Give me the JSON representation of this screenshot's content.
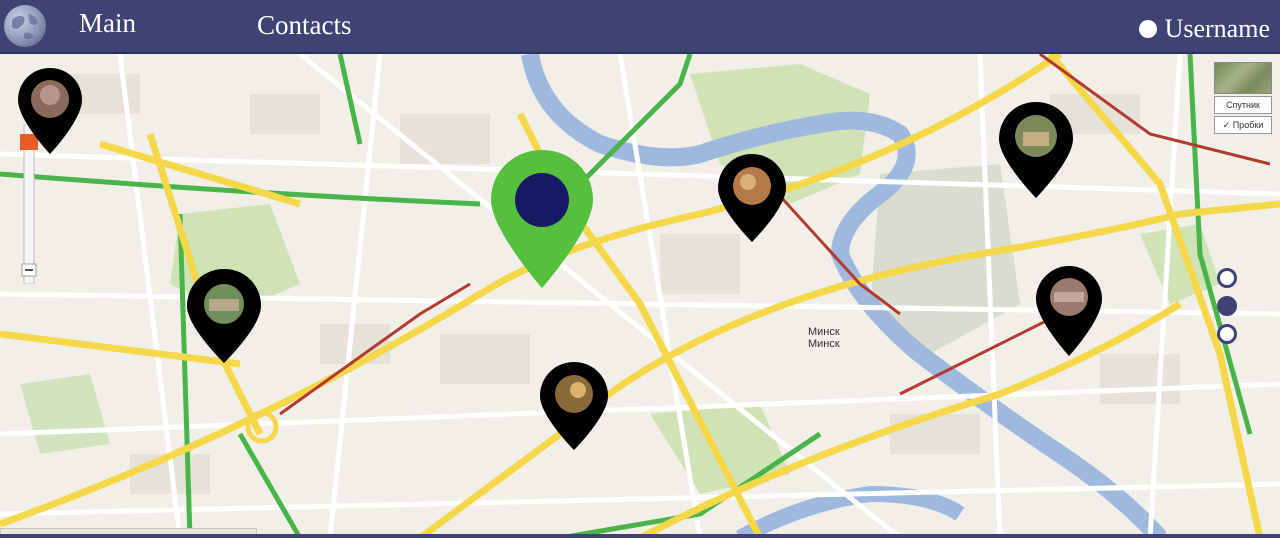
{
  "header": {
    "logo_icon": "globe-icon",
    "nav": [
      {
        "label": "Main"
      },
      {
        "label": "Contacts"
      }
    ],
    "user": {
      "label": "Username",
      "icon": "user-status-dot-icon"
    }
  },
  "map": {
    "city_label": "Минск",
    "city_label_2": "Минск",
    "map_controls": {
      "layer_label_1": "Спутник",
      "layer_label_2": "✓ Пробки"
    },
    "current_location_pin": {
      "icon": "current-location-pin-icon",
      "color": "#55c03d",
      "center_color": "#151a63"
    },
    "place_pins": [
      {
        "icon": "place-pin-icon"
      },
      {
        "icon": "place-pin-icon"
      },
      {
        "icon": "place-pin-icon"
      },
      {
        "icon": "place-pin-icon"
      },
      {
        "icon": "place-pin-icon"
      },
      {
        "icon": "place-pin-icon"
      }
    ],
    "pagination": {
      "total": 3,
      "active": 2
    }
  },
  "colors": {
    "header_bg": "#3f4373",
    "pin_color": "#000000",
    "current_pin_color": "#55c03d",
    "road_yellow": "#f5d74a",
    "road_green": "#49b449",
    "road_red": "#b23a2e"
  }
}
